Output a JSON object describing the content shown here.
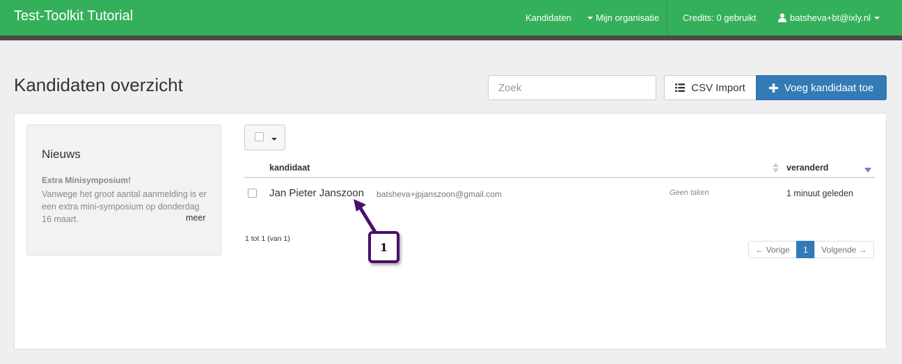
{
  "navbar": {
    "brand": "Test-Toolkit Tutorial",
    "kandidaten": "Kandidaten",
    "organisatie": "Mijn organisatie",
    "credits": "Credits: 0 gebruikt",
    "user": "batsheva+bt@ixly.nl",
    "color": "#35b05a"
  },
  "header": {
    "title": "Kandidaten overzicht",
    "search_placeholder": "Zoek",
    "csv_import": "CSV Import",
    "add_candidate": "Voeg kandidaat toe"
  },
  "news": {
    "title": "Nieuws",
    "heading": "Extra Minisymposium!",
    "body": "Vanwege het groot aantal aanmelding is er een extra mini-symposium op donderdag 16 maart.",
    "more": "meer"
  },
  "table": {
    "columns": {
      "candidate": "kandidaat",
      "changed": "veranderd"
    },
    "rows": [
      {
        "name": "Jan Pieter Janszoon",
        "email": "batsheva+jpjanszoon@gmail.com",
        "tasks": "Geen taken",
        "changed": "1 minuut geleden"
      }
    ],
    "info": "1 tot 1 (van 1)"
  },
  "pagination": {
    "prev": "← Vorige",
    "current": "1",
    "next": "Volgende →"
  },
  "callout": {
    "number": "1"
  }
}
